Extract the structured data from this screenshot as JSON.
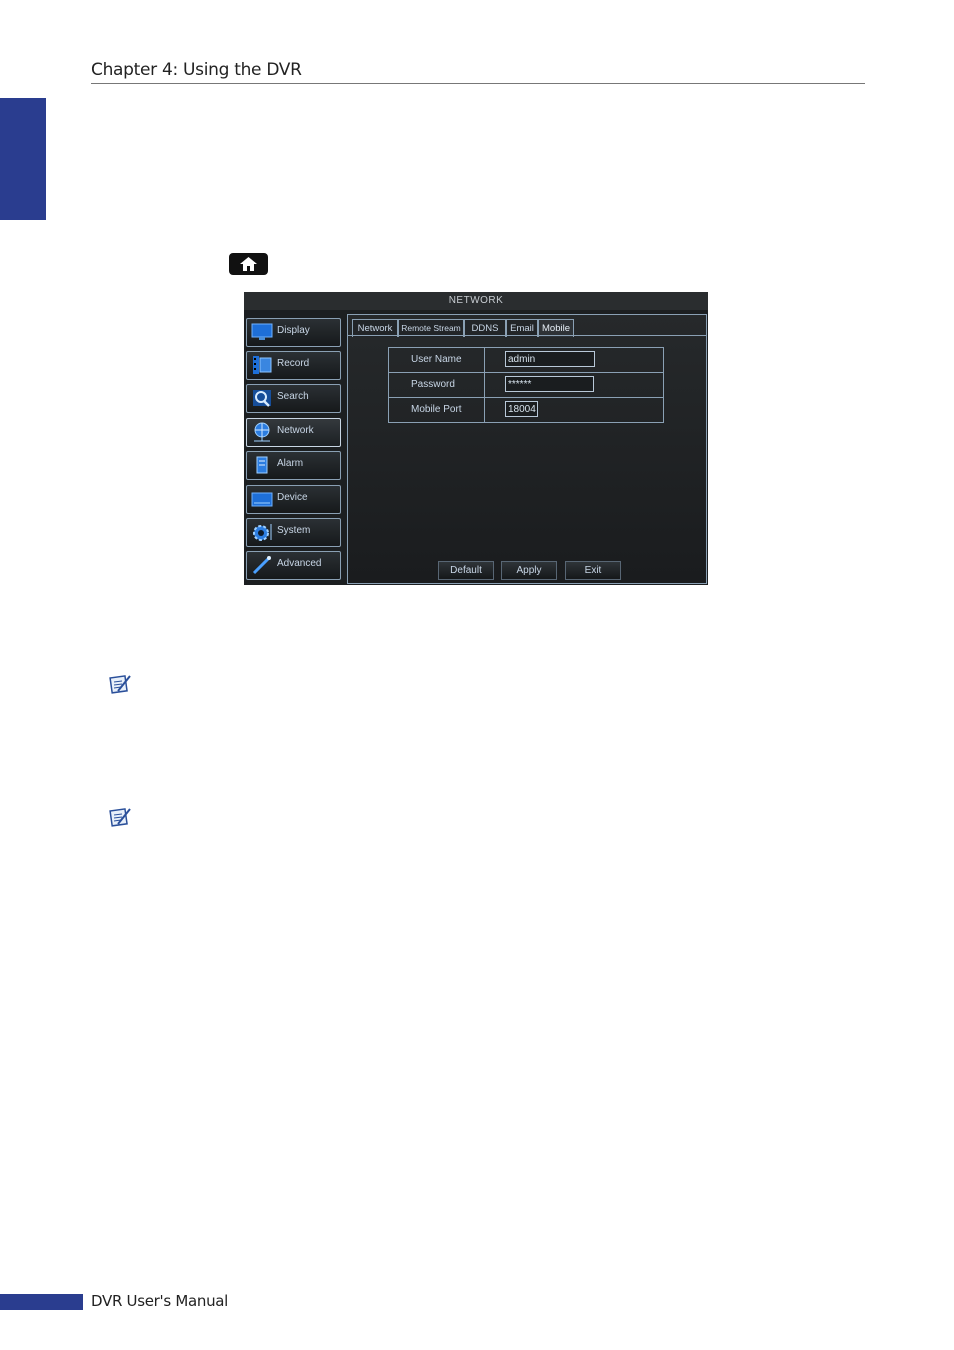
{
  "header": {
    "chapter_title": "Chapter 4: Using the DVR"
  },
  "home_key": {
    "icon": "home-icon"
  },
  "dvr_screen": {
    "title": "NETWORK",
    "menu": [
      {
        "label": "Display",
        "icon": "monitor-icon"
      },
      {
        "label": "Record",
        "icon": "film-icon"
      },
      {
        "label": "Search",
        "icon": "magnifier-icon"
      },
      {
        "label": "Network",
        "icon": "globe-icon"
      },
      {
        "label": "Alarm",
        "icon": "alarm-icon"
      },
      {
        "label": "Device",
        "icon": "device-icon"
      },
      {
        "label": "System",
        "icon": "gear-icon"
      },
      {
        "label": "Advanced",
        "icon": "wand-icon"
      }
    ],
    "active_menu": "Network",
    "tabs": [
      "Network",
      "Remote Stream",
      "DDNS",
      "Email",
      "Mobile"
    ],
    "active_tab": "Mobile",
    "fields": [
      {
        "label": "User Name",
        "value": "admin"
      },
      {
        "label": "Password",
        "value": "******"
      },
      {
        "label": "Mobile Port",
        "value": "18004"
      }
    ],
    "buttons": {
      "default": "Default",
      "apply": "Apply",
      "exit": "Exit"
    }
  },
  "notes": [
    "note-icon",
    "note-icon"
  ],
  "footer": {
    "manual_title": "DVR User's Manual"
  },
  "colors": {
    "accent_blue": "#2a3d8f",
    "dvr_border": "#8aa0b4",
    "dvr_background": "#1c1f21"
  }
}
